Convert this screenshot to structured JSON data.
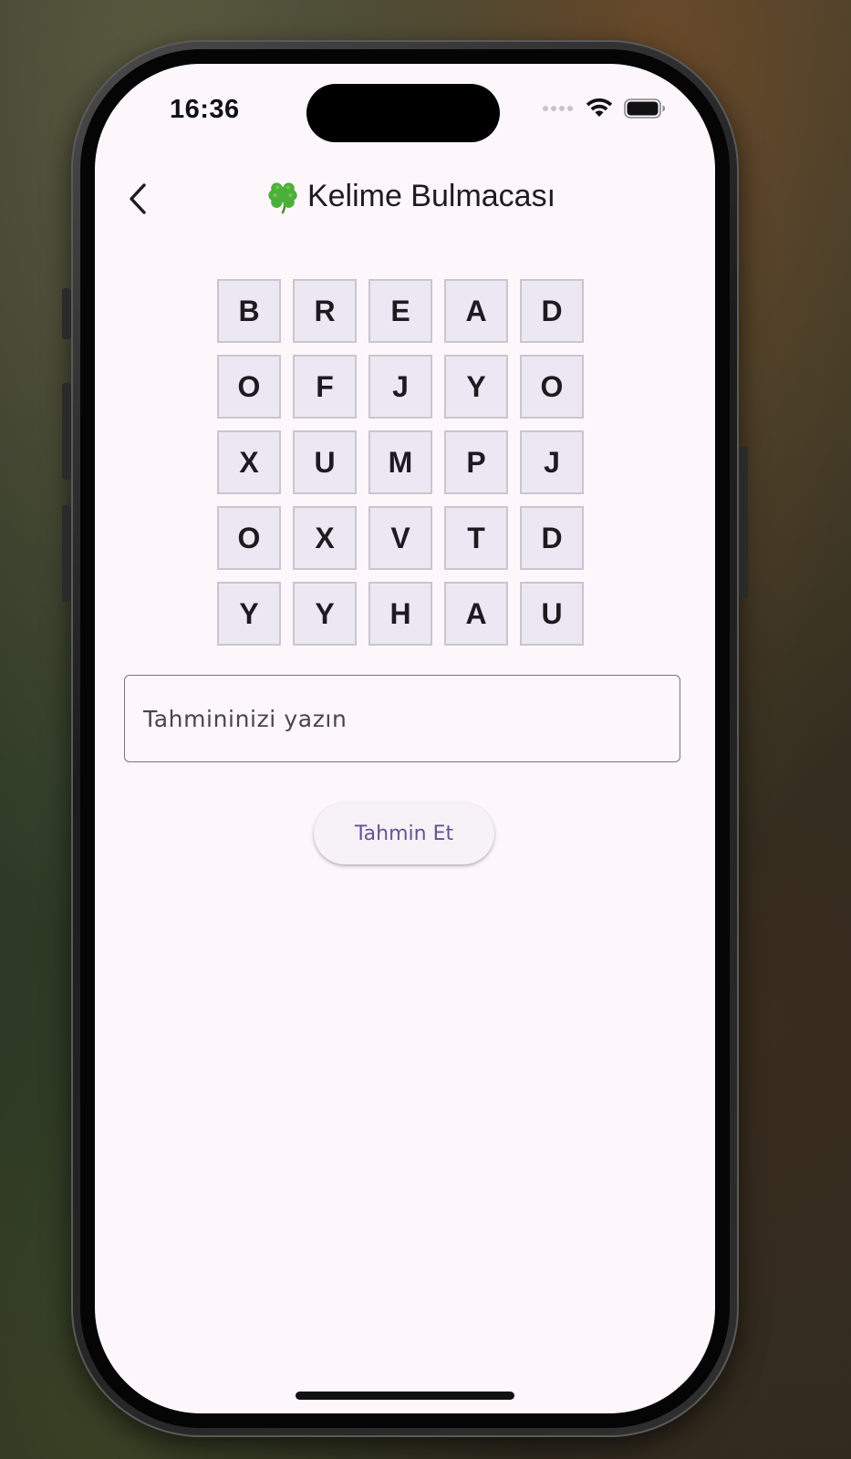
{
  "status_bar": {
    "time": "16:36"
  },
  "app_bar": {
    "back_icon": "chevron-left-icon",
    "title_icon": "four-leaf-clover-icon",
    "title": "Kelime Bulmacası"
  },
  "grid": {
    "rows": [
      [
        "B",
        "R",
        "E",
        "A",
        "D"
      ],
      [
        "O",
        "F",
        "J",
        "Y",
        "O"
      ],
      [
        "X",
        "U",
        "M",
        "P",
        "J"
      ],
      [
        "O",
        "X",
        "V",
        "T",
        "D"
      ],
      [
        "Y",
        "Y",
        "H",
        "A",
        "U"
      ]
    ]
  },
  "guess": {
    "value": "",
    "placeholder": "Tahmininizi yazın",
    "button_label": "Tahmin Et"
  },
  "colors": {
    "background": "#fdf7fc",
    "cell_fill": "#ece8f3",
    "accent": "#65558f"
  }
}
